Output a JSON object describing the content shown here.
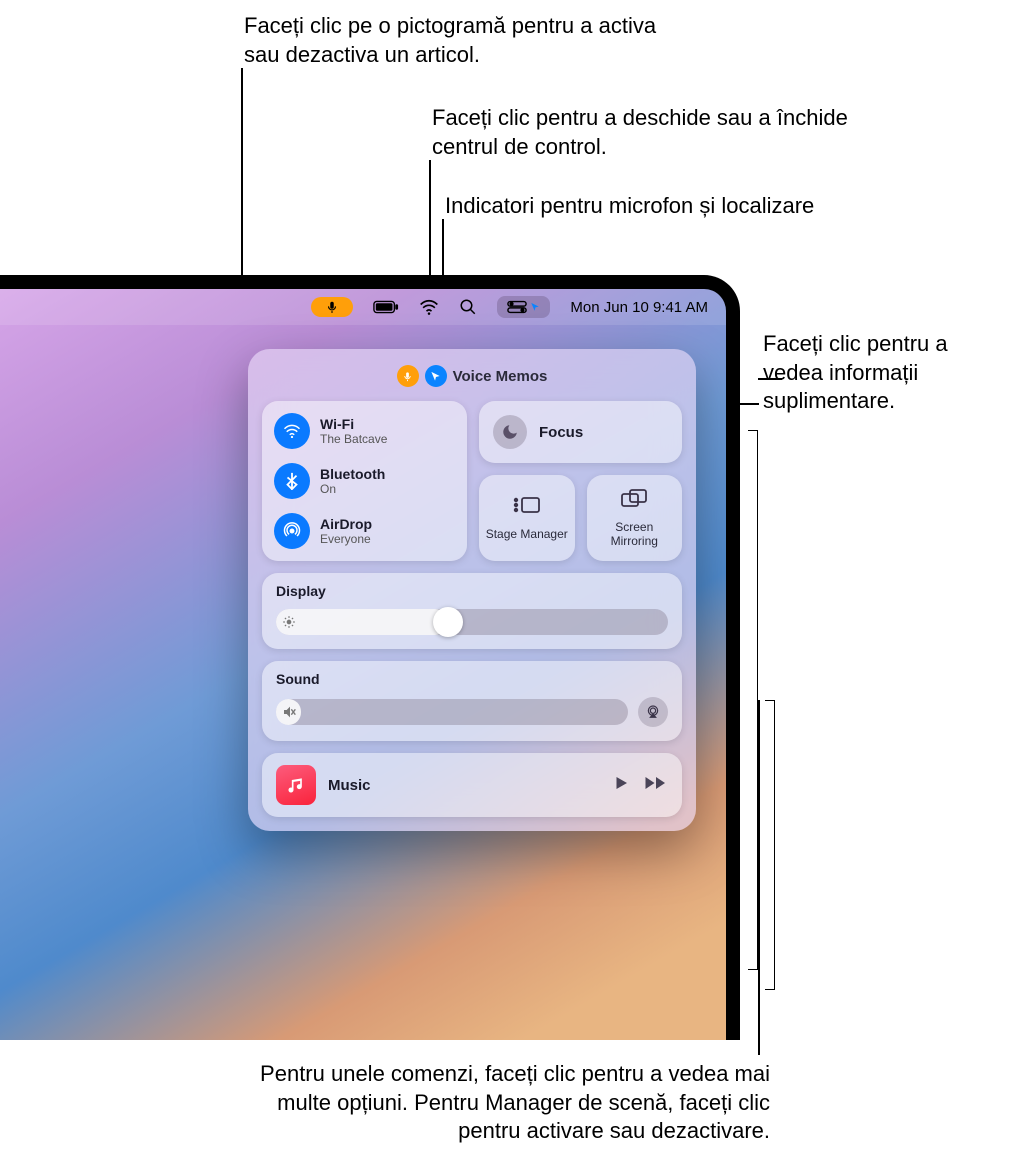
{
  "callouts": {
    "c1": "Faceți clic pe o pictogramă pentru a activa sau dezactiva un articol.",
    "c2": "Faceți clic pentru a deschide sau a închide centrul de control.",
    "c3": "Indicatori pentru microfon și localizare",
    "c4": "Faceți clic pentru a vedea informații suplimentare.",
    "c5": "Pentru unele comenzi, faceți clic pentru a vedea mai multe opțiuni. Pentru Manager de scenă, faceți clic pentru activare sau dezactivare."
  },
  "menubar": {
    "datetime": "Mon Jun 10  9:41 AM"
  },
  "indicators": {
    "app_label": "Voice Memos"
  },
  "network": {
    "wifi": {
      "title": "Wi-Fi",
      "sub": "The Batcave"
    },
    "bluetooth": {
      "title": "Bluetooth",
      "sub": "On"
    },
    "airdrop": {
      "title": "AirDrop",
      "sub": "Everyone"
    }
  },
  "focus": {
    "label": "Focus"
  },
  "tiles": {
    "stage": "Stage Manager",
    "screen": "Screen Mirroring"
  },
  "display": {
    "title": "Display"
  },
  "sound": {
    "title": "Sound"
  },
  "music": {
    "label": "Music"
  }
}
